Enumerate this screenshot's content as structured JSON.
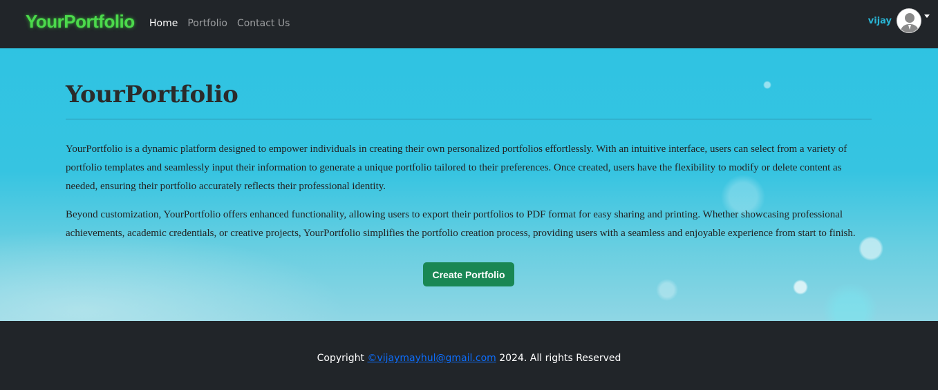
{
  "navbar": {
    "brand": "YourPortfolio",
    "links": [
      {
        "label": "Home",
        "active": true
      },
      {
        "label": "Portfolio",
        "active": false
      },
      {
        "label": "Contact Us",
        "active": false
      }
    ],
    "user": {
      "name": "vijay",
      "avatar_icon": "user-silhouette-icon",
      "menu_icon": "caret-down-icon"
    }
  },
  "hero": {
    "title": "YourPortfolio",
    "paragraph1": "YourPortfolio is a dynamic platform designed to empower individuals in creating their own personalized portfolios effortlessly. With an intuitive interface, users can select from a variety of portfolio templates and seamlessly input their information to generate a unique portfolio tailored to their preferences. Once created, users have the flexibility to modify or delete content as needed, ensuring their portfolio accurately reflects their professional identity.",
    "paragraph2": "Beyond customization, YourPortfolio offers enhanced functionality, allowing users to export their portfolios to PDF format for easy sharing and printing. Whether showcasing professional achievements, academic credentials, or creative projects, YourPortfolio simplifies the portfolio creation process, providing users with a seamless and enjoyable experience from start to finish.",
    "cta_label": "Create Portfolio"
  },
  "footer": {
    "prefix": "Copyright ",
    "email": "©vijaymayhul@gmail.com",
    "suffix": " 2024. All rights Reserved"
  },
  "colors": {
    "navbar_bg": "#212529",
    "brand": "#4cd94c",
    "user_name": "#29b6d6",
    "cta_bg": "#198754",
    "link": "#0d6efd"
  }
}
